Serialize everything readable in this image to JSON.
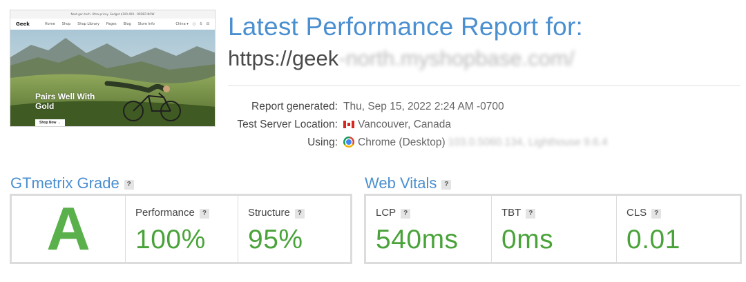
{
  "thumbnail": {
    "announcement": "Next-gen tech. Ultra-pricey. Gadget $100-499 · ORDER NOW",
    "logo": "Geek",
    "nav": [
      "Home",
      "Shop",
      "Shop Library",
      "Pages",
      "Blog",
      "Store Info"
    ],
    "nav_right": [
      "China ▾",
      "○",
      "♁",
      "⊟"
    ],
    "hero_heading_line1": "Pairs Well With",
    "hero_heading_line2": "Gold",
    "hero_button": "Shop Now →"
  },
  "report": {
    "title": "Latest Performance Report for:",
    "url_visible": "https://geek",
    "url_obscured": "-north.myshopbase.com/"
  },
  "meta": {
    "generated_label": "Report generated:",
    "generated_value": "Thu, Sep 15, 2022 2:24 AM -0700",
    "location_label": "Test Server Location:",
    "location_value": "Vancouver, Canada",
    "using_label": "Using:",
    "using_value": "Chrome (Desktop)",
    "using_obscured": "103.0.5060.134, Lighthouse 9.6.4"
  },
  "gtmetrix": {
    "title": "GTmetrix Grade",
    "grade": "A",
    "metrics": [
      {
        "label": "Performance",
        "value": "100%"
      },
      {
        "label": "Structure",
        "value": "95%"
      }
    ]
  },
  "web_vitals": {
    "title": "Web Vitals",
    "metrics": [
      {
        "label": "LCP",
        "value": "540ms"
      },
      {
        "label": "TBT",
        "value": "0ms"
      },
      {
        "label": "CLS",
        "value": "0.01"
      }
    ]
  },
  "help_glyph": "?",
  "colors": {
    "accent_blue": "#4a8fd0",
    "grade_green": "#5ab04a",
    "value_green": "#4aa33a",
    "panel_border": "#dcdcdc"
  }
}
